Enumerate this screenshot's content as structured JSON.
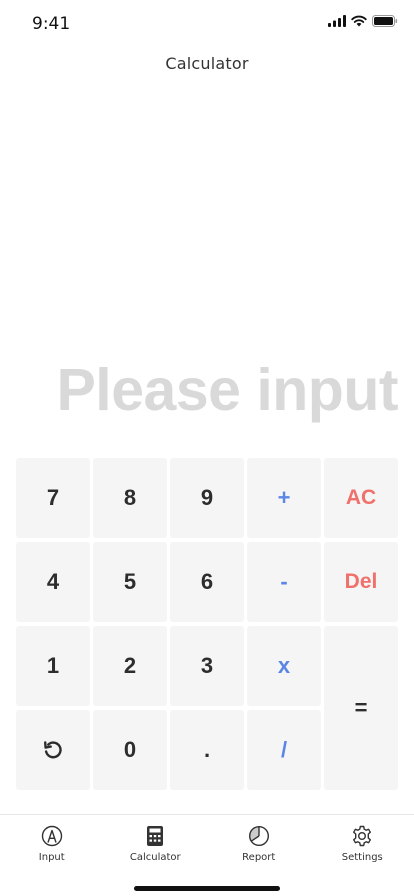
{
  "status_bar": {
    "time": "9:41",
    "icons": [
      "cellular-signal-icon",
      "wifi-icon",
      "battery-icon"
    ]
  },
  "header": {
    "title": "Calculator"
  },
  "display": {
    "placeholder": "Please input"
  },
  "keypad": {
    "rows": [
      [
        "7",
        "8",
        "9",
        "+",
        "AC"
      ],
      [
        "4",
        "5",
        "6",
        "-",
        "Del"
      ],
      [
        "1",
        "2",
        "3",
        "x",
        "="
      ],
      [
        "undo-icon",
        "0",
        ".",
        "/"
      ]
    ],
    "colors": {
      "operator": "#5b86e5",
      "danger": "#f0706b",
      "key_bg": "#f5f5f5"
    }
  },
  "tab_bar": {
    "tabs": [
      {
        "label": "Input",
        "icon": "pencil-circle-icon"
      },
      {
        "label": "Calculator",
        "icon": "calculator-icon",
        "active": true
      },
      {
        "label": "Report",
        "icon": "pie-chart-icon"
      },
      {
        "label": "Settings",
        "icon": "gear-icon"
      }
    ]
  }
}
